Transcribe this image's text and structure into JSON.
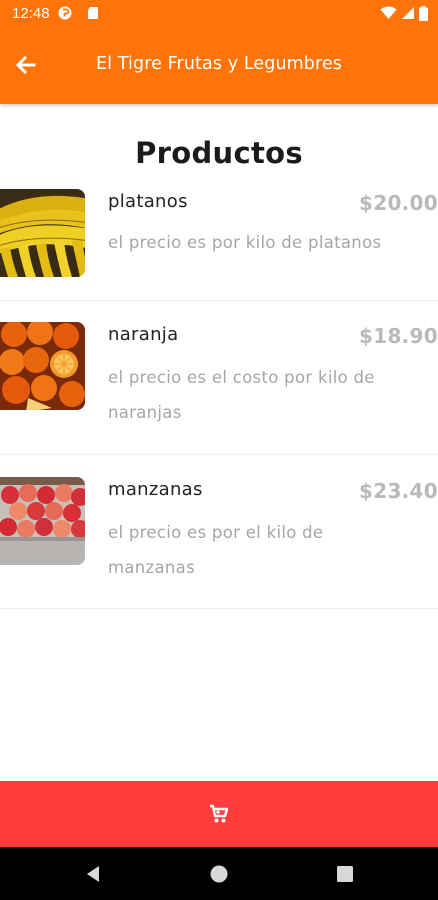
{
  "status_bar": {
    "time": "12:48",
    "icons": [
      "settings-notification-icon",
      "sd-card-icon",
      "wifi-icon",
      "signal-icon",
      "battery-icon"
    ]
  },
  "app_bar": {
    "title": "El Tigre Frutas y Legumbres",
    "back_icon": "arrow-left-icon",
    "color": "#ff7308"
  },
  "page": {
    "heading": "Productos"
  },
  "products": [
    {
      "name": "platanos",
      "price": "$20.00",
      "description": "el precio es por kilo de platanos",
      "image": "bananas"
    },
    {
      "name": "naranja",
      "price": "$18.90",
      "description": "el precio es el costo por kilo de naranjas",
      "image": "oranges"
    },
    {
      "name": "manzanas",
      "price": "$23.40",
      "description": "el precio es por el kilo de manzanas",
      "image": "apples"
    }
  ],
  "cart_bar": {
    "icon": "cart-icon",
    "color": "#ff3c3c"
  },
  "nav_bar": {
    "icons": [
      "back-triangle-icon",
      "home-circle-icon",
      "recents-square-icon"
    ]
  }
}
